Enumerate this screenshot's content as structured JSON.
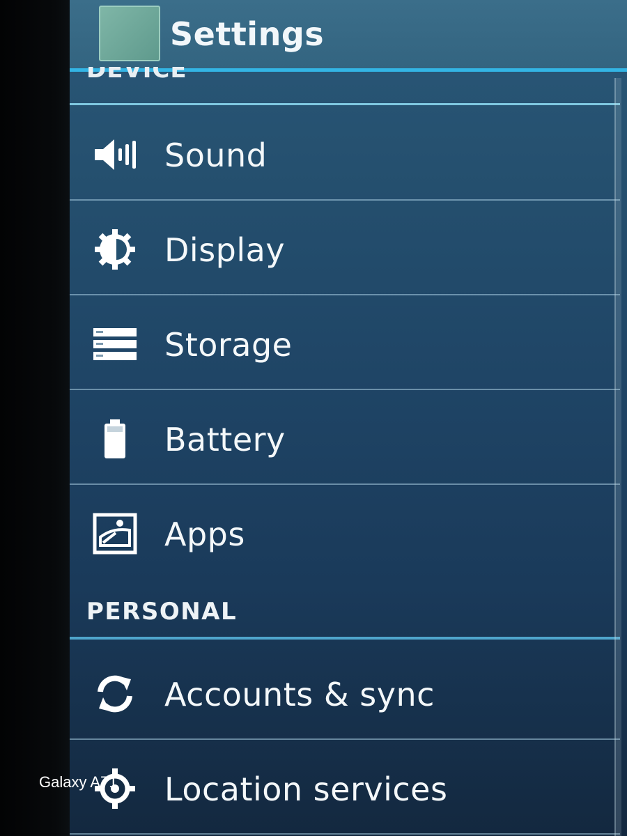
{
  "action_bar": {
    "title": "Settings"
  },
  "sections": {
    "device": "DEVICE",
    "personal": "PERSONAL"
  },
  "device_items": [
    {
      "label": "Sound",
      "icon": "speaker-icon"
    },
    {
      "label": "Display",
      "icon": "brightness-icon"
    },
    {
      "label": "Storage",
      "icon": "storage-icon"
    },
    {
      "label": "Battery",
      "icon": "battery-icon"
    },
    {
      "label": "Apps",
      "icon": "apps-icon"
    }
  ],
  "personal_items": [
    {
      "label": "Accounts & sync",
      "icon": "sync-icon"
    },
    {
      "label": "Location services",
      "icon": "location-icon"
    }
  ],
  "watermark": "Galaxy A71",
  "colors": {
    "accent": "#33b5e5",
    "background": "#1f4566",
    "text": "#f4f8fa"
  }
}
